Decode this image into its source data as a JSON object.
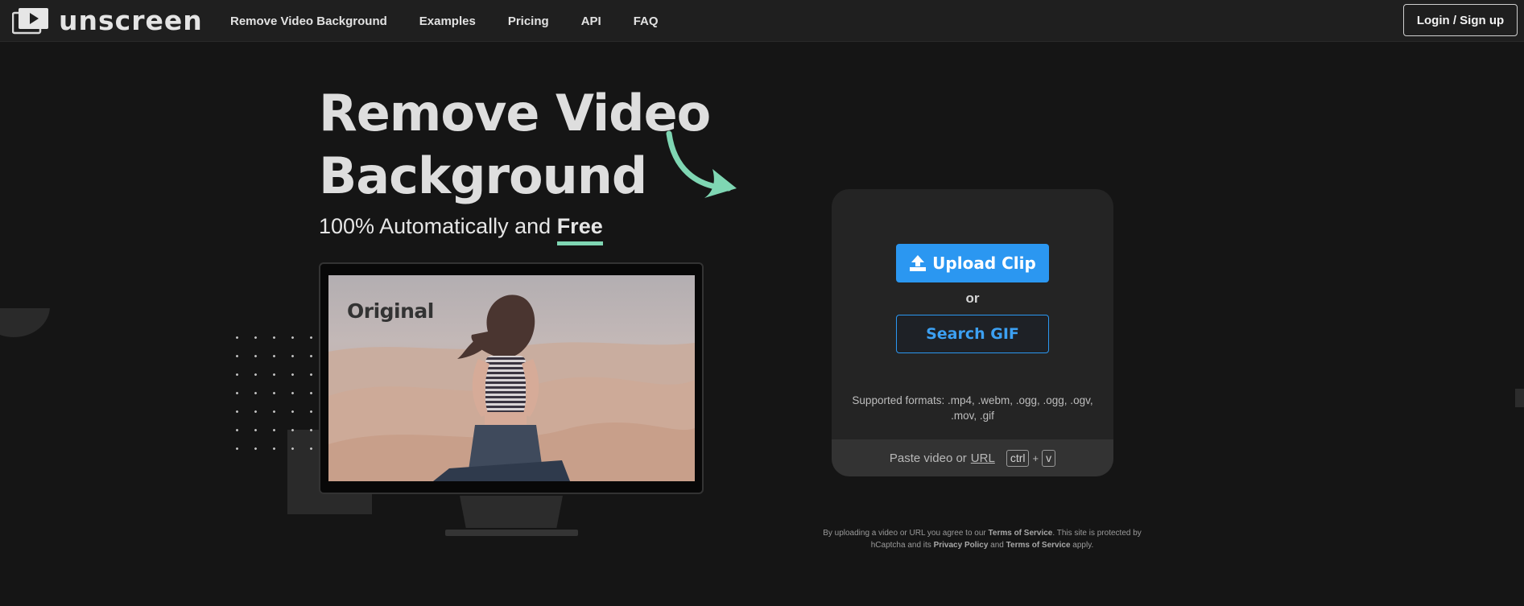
{
  "app": {
    "logo_text": "unscreen"
  },
  "nav": {
    "items": [
      "Remove Video Background",
      "Examples",
      "Pricing",
      "API",
      "FAQ"
    ],
    "login_label": "Login / Sign up"
  },
  "hero": {
    "title_line1": "Remove Video",
    "title_line2": "Background",
    "subtitle_prefix": "100% Automatically and ",
    "subtitle_highlight": "Free"
  },
  "preview": {
    "label": "Original"
  },
  "upload": {
    "upload_label": "Upload Clip",
    "or_text": "or",
    "search_label": "Search GIF",
    "formats_line1": "Supported formats: .mp4, .webm, .ogg, .ogg, .ogv,",
    "formats_line2": ".mov, .gif",
    "paste_prefix": "Paste video or",
    "paste_url": "URL",
    "key_ctrl": "ctrl",
    "key_plus": "+",
    "key_v": "v"
  },
  "legal": {
    "part1": "By uploading a video or URL you agree to our ",
    "terms1": "Terms of Service",
    "part2": ". This site is protected by hCaptcha and its ",
    "privacy": "Privacy Policy",
    "part3": " and ",
    "terms2": "Terms of Service",
    "part4": " apply."
  },
  "colors": {
    "background": "#151515",
    "topbar": "#1f1f1f",
    "accent_blue": "#2b97f1",
    "accent_green": "#7fd6b3",
    "card": "#242424"
  },
  "icons": [
    "logo-icon",
    "arrow-icon",
    "upload-icon"
  ]
}
